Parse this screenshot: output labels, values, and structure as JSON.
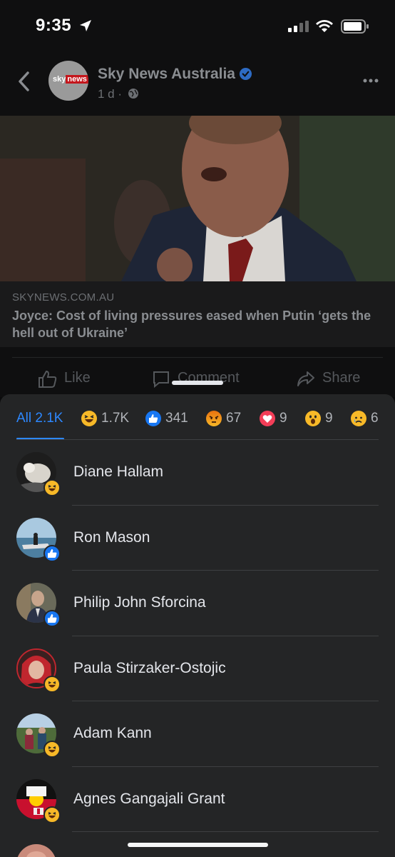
{
  "status_bar": {
    "time": "9:35"
  },
  "post": {
    "page_name": "Sky News Australia",
    "avatar_logo_sky": "sky",
    "avatar_logo_news": "news",
    "age": "1 d ·",
    "link_domain": "SKYNEWS.COM.AU",
    "link_title": "Joyce: Cost of living pressures eased when Putin ‘gets the hell out of Ukraine’"
  },
  "actions": {
    "like": "Like",
    "comment": "Comment",
    "share": "Share"
  },
  "reactions": {
    "tabs": [
      {
        "label": "All 2.1K",
        "icon": ""
      },
      {
        "label": "1.7K",
        "icon": "haha-icon"
      },
      {
        "label": "341",
        "icon": "like-icon"
      },
      {
        "label": "67",
        "icon": "angry-icon"
      },
      {
        "label": "9",
        "icon": "love-icon"
      },
      {
        "label": "9",
        "icon": "wow-icon"
      },
      {
        "label": "6",
        "icon": "sad-icon"
      }
    ],
    "people": [
      {
        "name": "Diane Hallam",
        "reaction": "haha-icon"
      },
      {
        "name": "Ron Mason",
        "reaction": "like-icon"
      },
      {
        "name": "Philip John Sforcina",
        "reaction": "like-icon"
      },
      {
        "name": "Paula Stirzaker-Ostojic",
        "reaction": "haha-icon"
      },
      {
        "name": "Adam Kann",
        "reaction": "haha-icon"
      },
      {
        "name": "Agnes Gangajali Grant",
        "reaction": "haha-icon"
      }
    ]
  },
  "colors": {
    "accent": "#2d88ff",
    "sheet_bg": "#242526",
    "haha": "#f7b928",
    "like": "#1877f2",
    "angry": "#e9710f",
    "love": "#f33e58"
  }
}
